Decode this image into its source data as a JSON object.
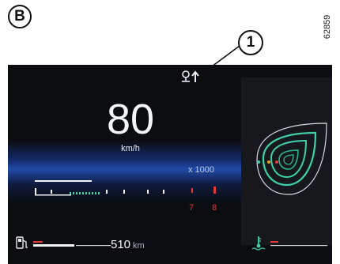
{
  "figure": {
    "label": "B",
    "reference": "62859",
    "callout": "1"
  },
  "dashboard": {
    "speed": {
      "value": "80",
      "unit": "km/h"
    },
    "tachometer": {
      "multiplier_label": "x 1000",
      "redline_labels": [
        "7",
        "8"
      ]
    },
    "fuel": {
      "range_value": "510",
      "range_unit": "km"
    },
    "icons": {
      "nav": "navigation-pin-arrow-icon",
      "fuel": "fuel-pump-icon",
      "temperature": "coolant-temperature-icon",
      "eco": "eco-drop-icon"
    },
    "colors": {
      "accent": "#3fd1a6",
      "warning": "#e23a3a",
      "glow": "#2a5fdc"
    }
  }
}
